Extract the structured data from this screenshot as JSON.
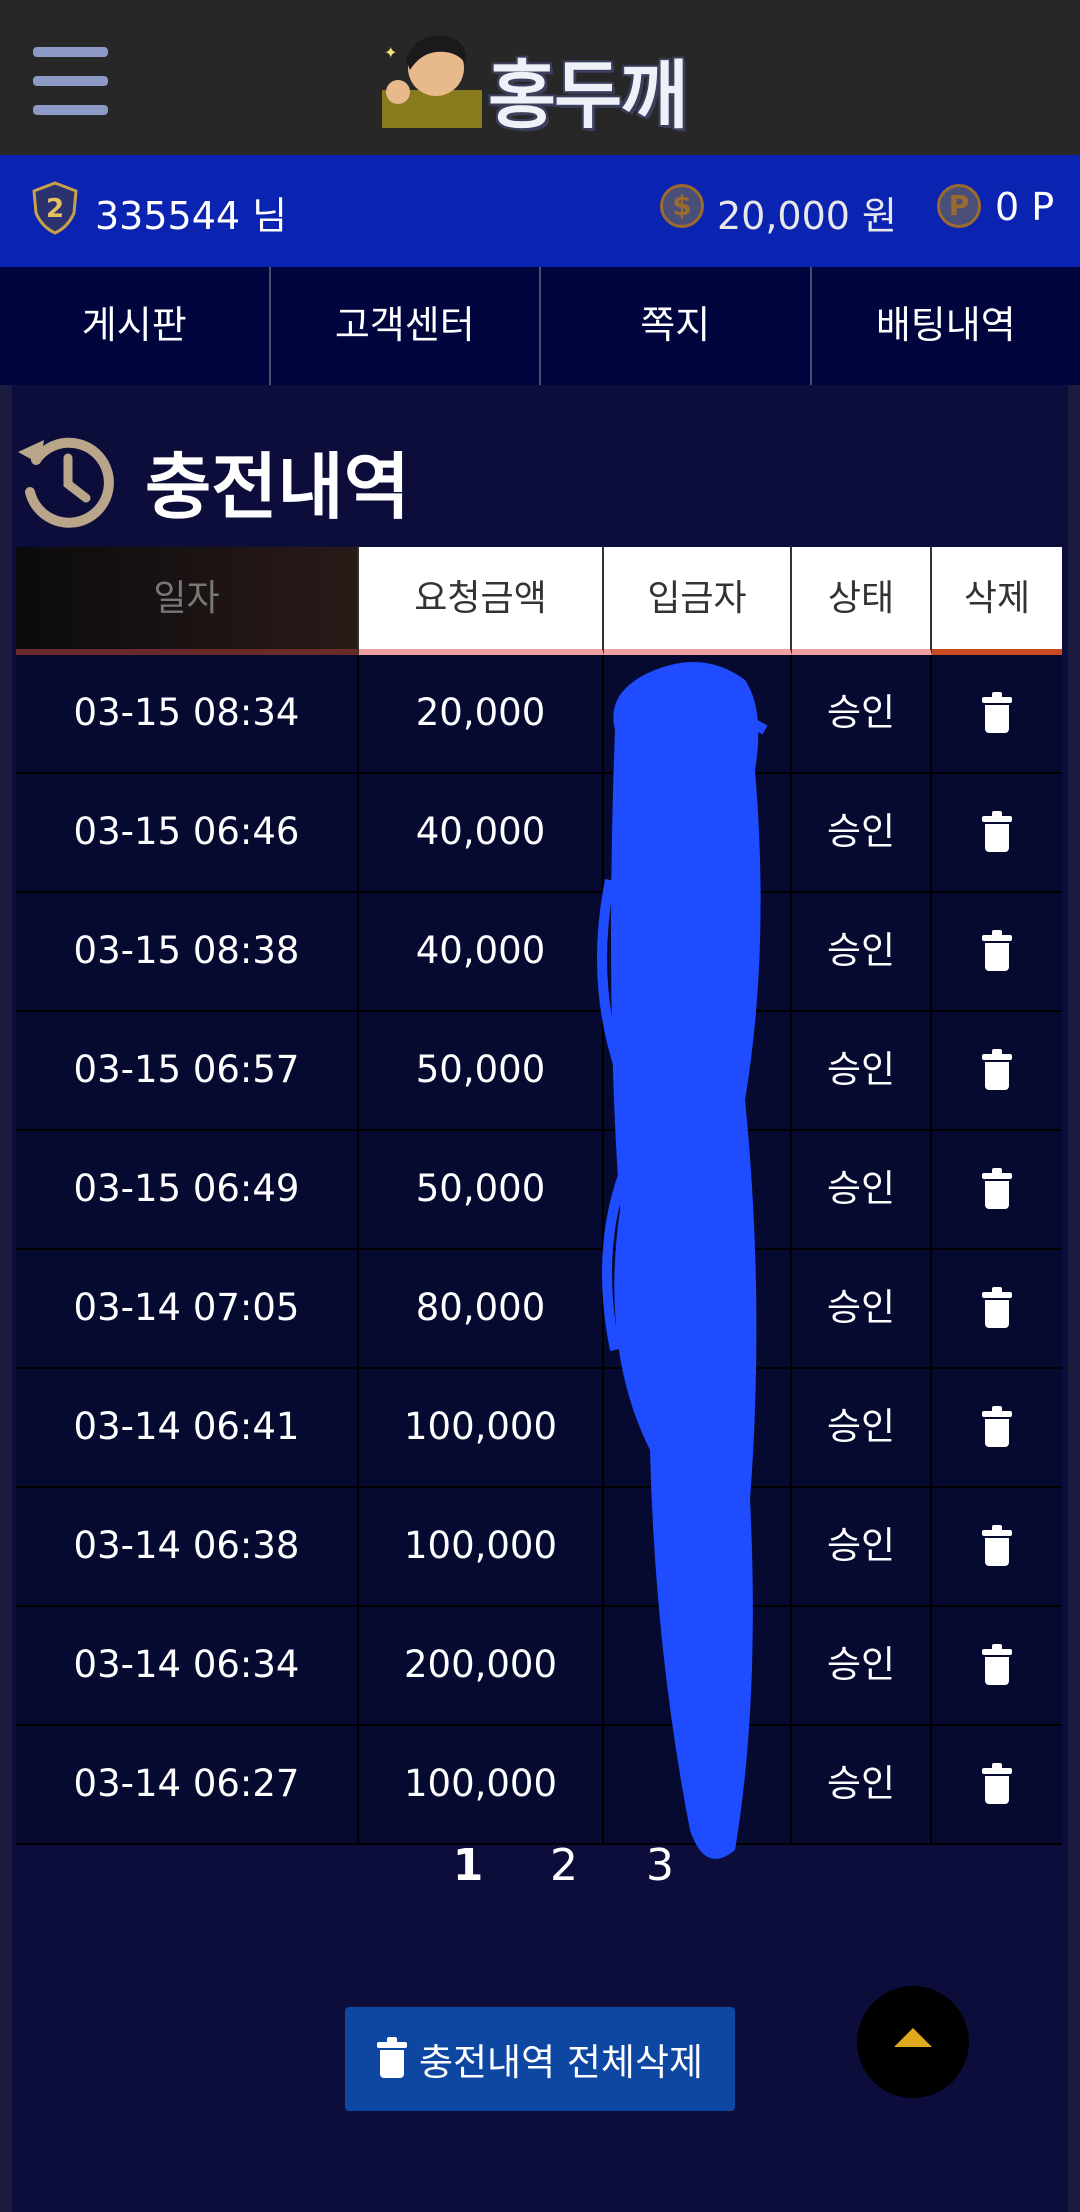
{
  "header": {
    "menu_icon": "hamburger-menu-icon",
    "logo_text": "홍두깨"
  },
  "userbar": {
    "username": "335544 님",
    "level_badge_text": "2",
    "money": "20,000 원",
    "money_icon_glyph": "$",
    "points": "0 P",
    "point_icon_glyph": "P"
  },
  "nav": {
    "items": [
      {
        "label": "게시판"
      },
      {
        "label": "고객센터"
      },
      {
        "label": "쪽지"
      },
      {
        "label": "배팅내역"
      }
    ]
  },
  "page": {
    "title": "충전내역",
    "title_icon": "history-icon"
  },
  "table": {
    "headers": [
      "일자",
      "요청금액",
      "입금자",
      "상태",
      "삭제"
    ],
    "rows": [
      {
        "date": "03-15 08:34",
        "amount": "20,000",
        "depositor": "",
        "status": "승인"
      },
      {
        "date": "03-15 06:46",
        "amount": "40,000",
        "depositor": "",
        "status": "승인"
      },
      {
        "date": "03-15 08:38",
        "amount": "40,000",
        "depositor": "",
        "status": "승인"
      },
      {
        "date": "03-15 06:57",
        "amount": "50,000",
        "depositor": "",
        "status": "승인"
      },
      {
        "date": "03-15 06:49",
        "amount": "50,000",
        "depositor": "",
        "status": "승인"
      },
      {
        "date": "03-14 07:05",
        "amount": "80,000",
        "depositor": "",
        "status": "승인"
      },
      {
        "date": "03-14 06:41",
        "amount": "100,000",
        "depositor": "",
        "status": "승인"
      },
      {
        "date": "03-14 06:38",
        "amount": "100,000",
        "depositor": "",
        "status": "승인"
      },
      {
        "date": "03-14 06:34",
        "amount": "200,000",
        "depositor": "",
        "status": "승인"
      },
      {
        "date": "03-14 06:27",
        "amount": "100,000",
        "depositor": "",
        "status": "승인"
      }
    ]
  },
  "pagination": {
    "pages": [
      "1",
      "2",
      "3"
    ],
    "current": "1"
  },
  "actions": {
    "delete_all_label": "충전내역 전체삭제",
    "scroll_top_icon": "chevron-up-icon"
  },
  "colors": {
    "header_bg": "#272727",
    "userbar_bg": "#0a23b0",
    "nav_bg": "#00063d",
    "content_bg": "#0c0d3a",
    "button_bg": "#0d47a1",
    "accent_gold": "#e0a81d",
    "redaction": "#1f4cff"
  }
}
